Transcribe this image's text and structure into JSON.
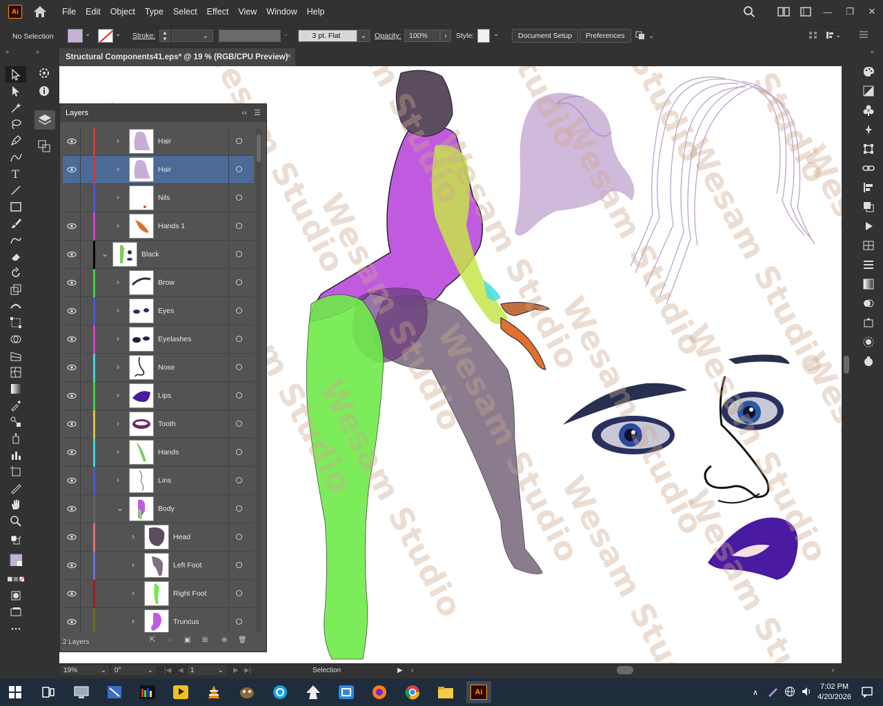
{
  "app": {
    "logo_text": "Ai"
  },
  "menu": {
    "items": [
      "File",
      "Edit",
      "Object",
      "Type",
      "Select",
      "Effect",
      "View",
      "Window",
      "Help"
    ]
  },
  "control_bar": {
    "selection_label": "No Selection",
    "stroke_label": "Stroke:",
    "brush_value": "3 pt. Flat",
    "opacity_label": "Opacity:",
    "opacity_value": "100%",
    "style_label": "Style:",
    "document_setup": "Document Setup",
    "preferences": "Preferences"
  },
  "document_tab": {
    "title": "Structural Components41.eps* @ 19 % (RGB/CPU Preview)",
    "close": "×"
  },
  "layers_panel": {
    "title": "Layers",
    "footer_count": "2 Layers",
    "rows": [
      {
        "name": "Hair",
        "color": "#d23b3b",
        "selected": false,
        "expanded": false,
        "indent": 0
      },
      {
        "name": "Hair",
        "color": "#d23b3b",
        "selected": true,
        "expanded": false,
        "indent": 0
      },
      {
        "name": "Nils",
        "color": "#4a56d6",
        "selected": false,
        "expanded": false,
        "indent": 0,
        "hidden": true
      },
      {
        "name": "Hands 1",
        "color": "#d63ec8",
        "selected": false,
        "expanded": false,
        "indent": 0
      },
      {
        "name": "Black",
        "color": "#000000",
        "selected": false,
        "expanded": true,
        "indent": -1
      },
      {
        "name": "Brow",
        "color": "#3fcf3f",
        "selected": false,
        "expanded": false,
        "indent": 0
      },
      {
        "name": "Eyes",
        "color": "#4a56d6",
        "selected": false,
        "expanded": false,
        "indent": 0
      },
      {
        "name": "Eyelashes",
        "color": "#d63ec8",
        "selected": false,
        "expanded": false,
        "indent": 0
      },
      {
        "name": "Nose",
        "color": "#3fd6d6",
        "selected": false,
        "expanded": false,
        "indent": 0
      },
      {
        "name": "Lips",
        "color": "#3fcf3f",
        "selected": false,
        "expanded": false,
        "indent": 0
      },
      {
        "name": "Tooth",
        "color": "#d6c43a",
        "selected": false,
        "expanded": false,
        "indent": 0
      },
      {
        "name": "Hands",
        "color": "#3fd6d6",
        "selected": false,
        "expanded": false,
        "indent": 0
      },
      {
        "name": "Lins",
        "color": "#4a56d6",
        "selected": false,
        "expanded": false,
        "indent": 0
      },
      {
        "name": "Body",
        "color": "#666666",
        "selected": false,
        "expanded": true,
        "indent": 0
      },
      {
        "name": "Head",
        "color": "#e07070",
        "selected": false,
        "expanded": false,
        "indent": 1
      },
      {
        "name": "Left Foot",
        "color": "#7070d6",
        "selected": false,
        "expanded": false,
        "indent": 1
      },
      {
        "name": "Right Foot",
        "color": "#a01c1c",
        "selected": false,
        "expanded": false,
        "indent": 1
      },
      {
        "name": "Truncus",
        "color": "#6b6b20",
        "selected": false,
        "expanded": false,
        "indent": 1
      }
    ]
  },
  "status_bar": {
    "zoom": "19%",
    "rotation": "0°",
    "artboard": "1",
    "mode": "Selection"
  },
  "taskbar": {
    "time": "7:02 PM",
    "date": "4/20/2026",
    "ai_label": "Ai"
  },
  "watermark": {
    "text": "Wesam Studio"
  },
  "colors": {
    "fill_swatch": "#c8b0d6",
    "selection_blue": "#4b6a96",
    "ui_dark": "#323232"
  }
}
